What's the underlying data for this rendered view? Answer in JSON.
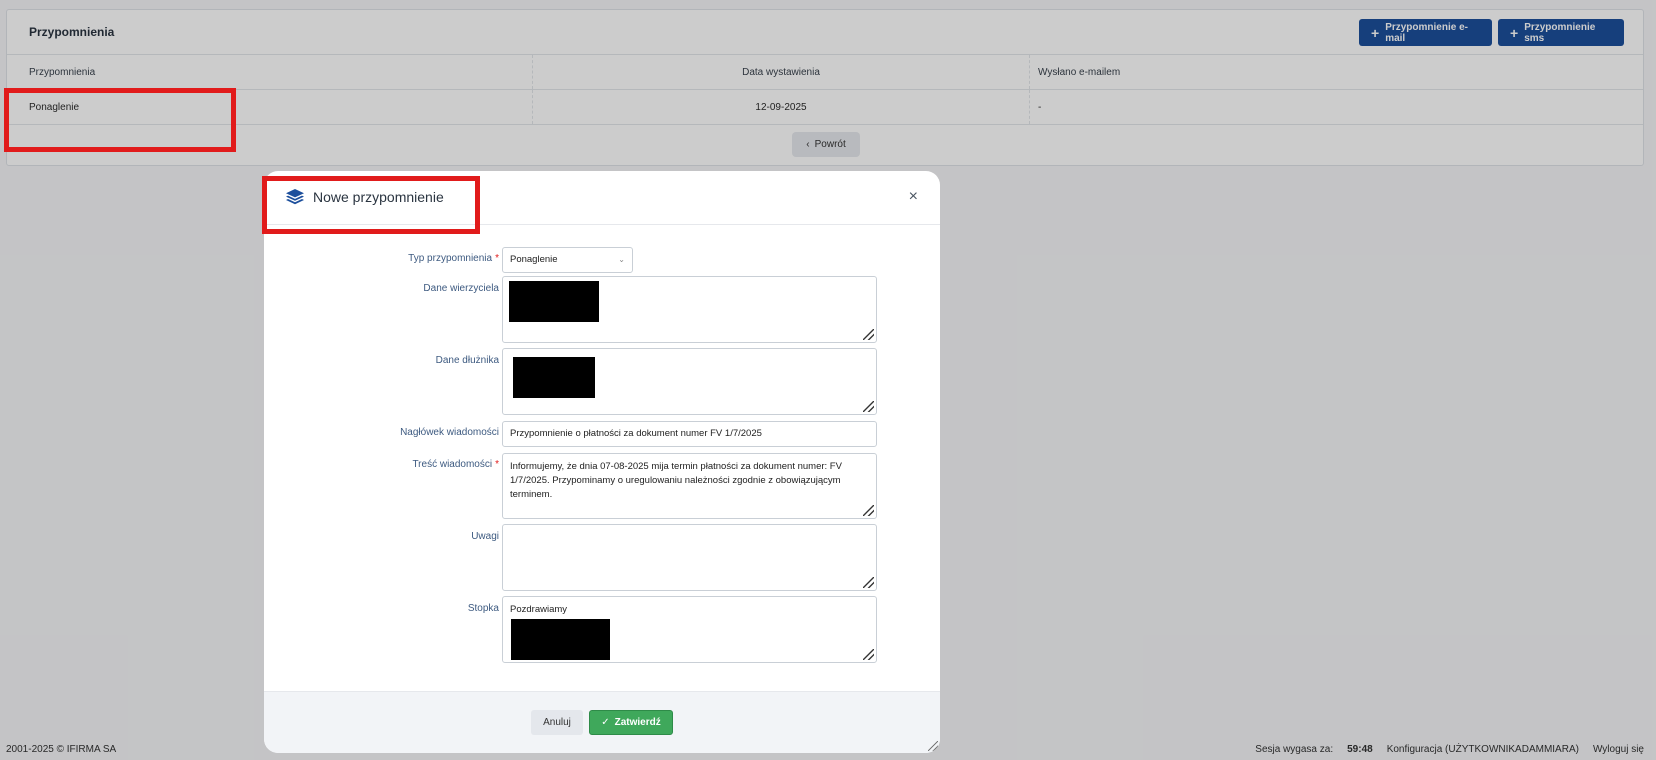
{
  "card": {
    "title": "Przypomnienia",
    "email_button_label": "Przypomnienie e-mail",
    "sms_button_label": "Przypomnienie sms",
    "table": {
      "headers": [
        "Przypomnienia",
        "Data wystawienia",
        "Wysłano e-mailem"
      ],
      "rows": [
        [
          "Ponaglenie",
          "12-09-2025",
          "-"
        ]
      ]
    },
    "back_button_label": "Powrót"
  },
  "footer": {
    "copyright": "2001-2025 ©  IFIRMA SA",
    "session_label": "Sesja wygasa za:",
    "session_timer": "59:48",
    "config_link": "Konfiguracja (UŻYTKOWNIKADAMMIARA)",
    "logout_link": "Wyloguj się"
  },
  "modal": {
    "title": "Nowe przypomnienie",
    "close_symbol": "×",
    "fields": {
      "type": {
        "label": "Typ przypomnienia",
        "value": "Ponaglenie"
      },
      "creditor": {
        "label": "Dane wierzyciela",
        "value": ""
      },
      "debtor": {
        "label": "Dane dłużnika",
        "value": ""
      },
      "subject": {
        "label": "Nagłówek wiadomości",
        "value": "Przypomnienie o płatności za dokument numer FV 1/7/2025"
      },
      "body": {
        "label": "Treść wiadomości",
        "value": "Informujemy, że dnia 07-08-2025 mija termin płatności za dokument numer: FV 1/7/2025. Przypominamy o uregulowaniu należności zgodnie z obowiązującym terminem."
      },
      "notes": {
        "label": "Uwagi",
        "value": ""
      },
      "footer": {
        "label": "Stopka",
        "value": "Pozdrawiamy"
      }
    },
    "cancel_label": "Anuluj",
    "submit_label": "Zatwierdź"
  },
  "colors": {
    "primary": "#1c4f9c",
    "success": "#3fa85b",
    "highlight": "#e11b1b",
    "label": "#3d5a80"
  }
}
